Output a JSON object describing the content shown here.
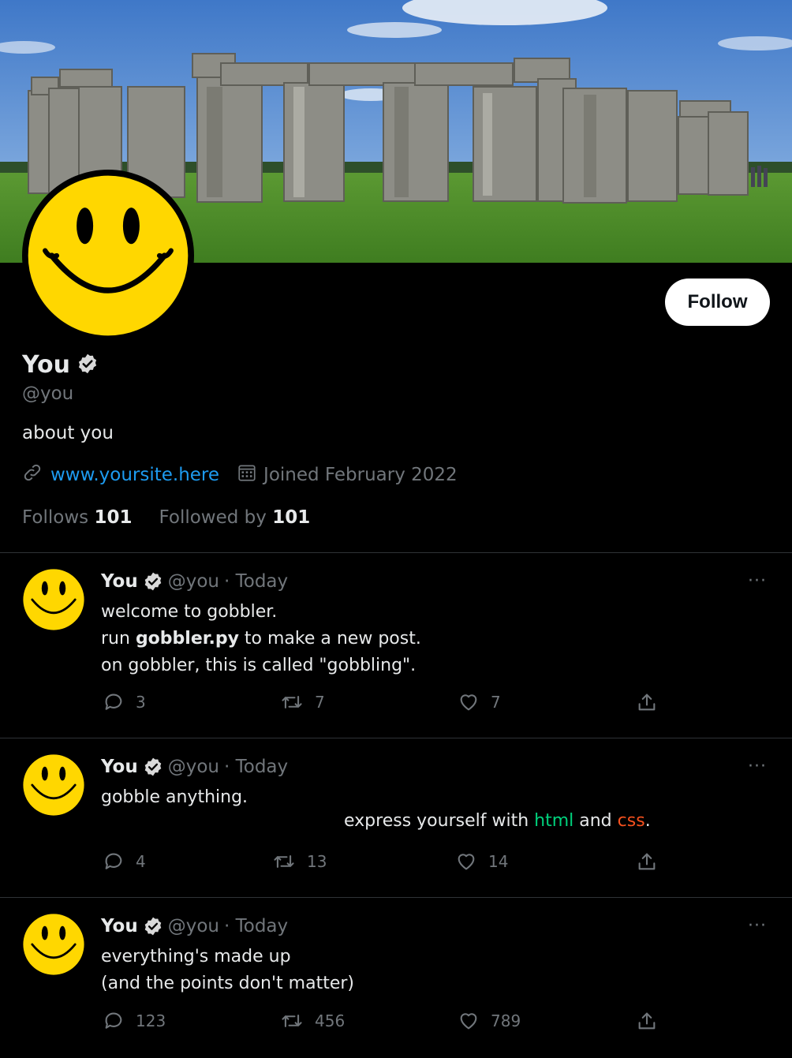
{
  "profile": {
    "name": "You",
    "handle": "@you",
    "bio": "about you",
    "website": "www.yoursite.here",
    "joined": "Joined February 2022",
    "follows_label": "Follows",
    "follows_count": "101",
    "followed_by_label": "Followed by",
    "followed_by_count": "101",
    "follow_button": "Follow"
  },
  "colors": {
    "background": "#000000",
    "text": "#e7e9ea",
    "muted": "#71767b",
    "link": "#1d9bf0",
    "smiley": "#ffd700",
    "html_accent": "#00d17c",
    "css_accent": "#f5501e"
  },
  "icons": {
    "verified": "verified-badge-icon",
    "link": "link-icon",
    "calendar": "calendar-icon",
    "reply": "reply-icon",
    "repost": "repost-icon",
    "like": "heart-icon",
    "share": "share-icon",
    "more": "more-icon"
  },
  "posts": [
    {
      "name": "You",
      "handle": "@you",
      "time": "· Today",
      "more": "···",
      "lines": [
        "welcome to gobbler.",
        "run ",
        "gobbler.py",
        " to make a new post.",
        "on gobbler, this is called \"gobbling\"."
      ],
      "replies": "3",
      "reposts": "7",
      "likes": "7"
    },
    {
      "name": "You",
      "handle": "@you",
      "time": "· Today",
      "more": "···",
      "line1": "gobble anything.",
      "line2_a": "express yourself with ",
      "line2_html": "html",
      "line2_b": " and ",
      "line2_css": "css",
      "line2_c": ".",
      "replies": "4",
      "reposts": "13",
      "likes": "14"
    },
    {
      "name": "You",
      "handle": "@you",
      "time": "· Today",
      "more": "···",
      "line1": "everything's made up",
      "line2": "(and the points don't matter)",
      "replies": "123",
      "reposts": "456",
      "likes": "789"
    }
  ]
}
